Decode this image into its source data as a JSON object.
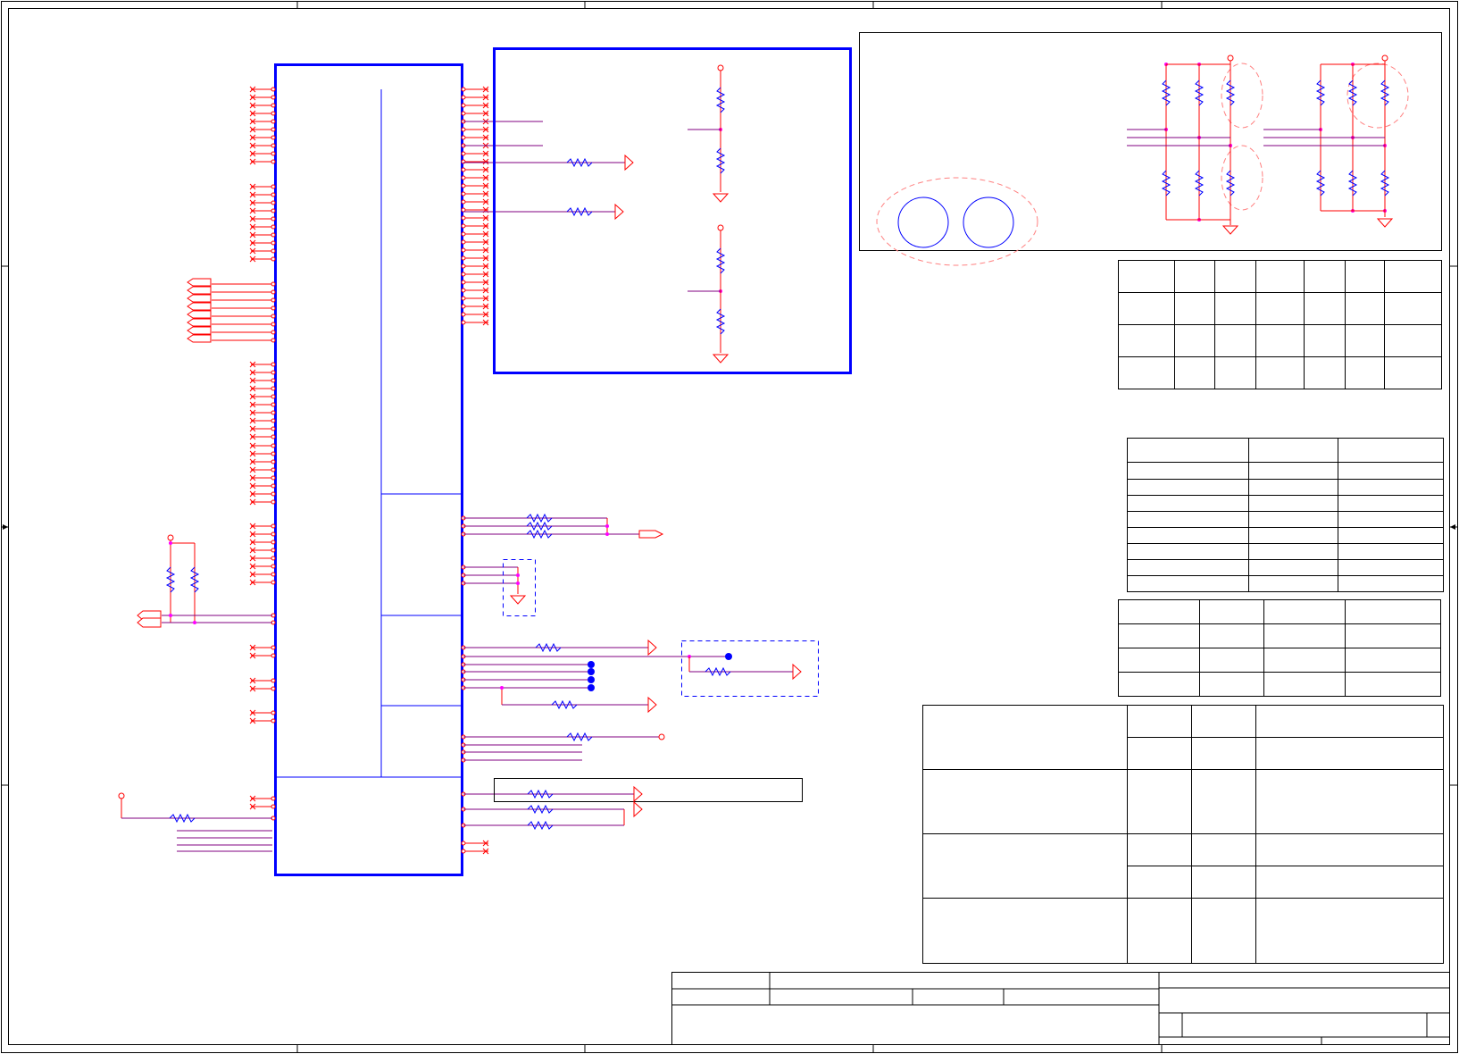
{
  "colors": {
    "frame": "#000000",
    "block": "#0000ff",
    "net": "#ff0000",
    "bus": "#800080",
    "junction": "#ff00ff",
    "component": "#0000ff",
    "keepout": "#ff8080",
    "background": "#ffffff"
  },
  "icons": {
    "resistor": "resistor-icon",
    "ground": "ground-icon",
    "power": "power-pin-icon",
    "no_connect": "no-connect-icon",
    "port": "offpage-port-icon",
    "test_point": "test-point-icon",
    "mounting_hole": "mounting-hole-icon"
  }
}
